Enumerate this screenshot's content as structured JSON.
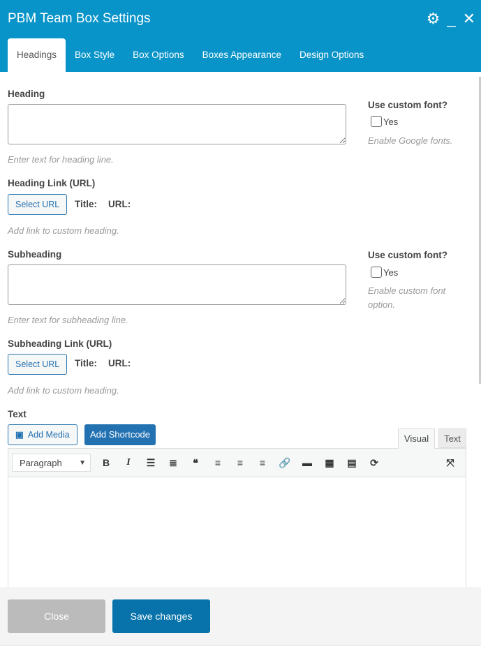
{
  "window": {
    "title": "PBM Team Box Settings"
  },
  "tabs": [
    "Headings",
    "Box Style",
    "Box Options",
    "Boxes Appearance",
    "Design Options"
  ],
  "heading": {
    "label": "Heading",
    "value": "",
    "hint": "Enter text for heading line.",
    "custom_font_label": "Use custom font?",
    "yes": "Yes",
    "font_hint": "Enable Google fonts."
  },
  "heading_link": {
    "label": "Heading Link (URL)",
    "button": "Select URL",
    "title": "Title:",
    "url": "URL:",
    "hint": "Add link to custom heading."
  },
  "subheading": {
    "label": "Subheading",
    "value": "",
    "hint": "Enter text for subheading line.",
    "custom_font_label": "Use custom font?",
    "yes": "Yes",
    "font_hint": "Enable custom font option."
  },
  "subheading_link": {
    "label": "Subheading Link (URL)",
    "button": "Select URL",
    "title": "Title:",
    "url": "URL:",
    "hint": "Add link to custom heading."
  },
  "text": {
    "label": "Text",
    "add_media": "Add Media",
    "add_shortcode": "Add Shortcode",
    "visual_tab": "Visual",
    "text_tab": "Text",
    "format": "Paragraph"
  },
  "footer": {
    "close": "Close",
    "save": "Save changes"
  }
}
